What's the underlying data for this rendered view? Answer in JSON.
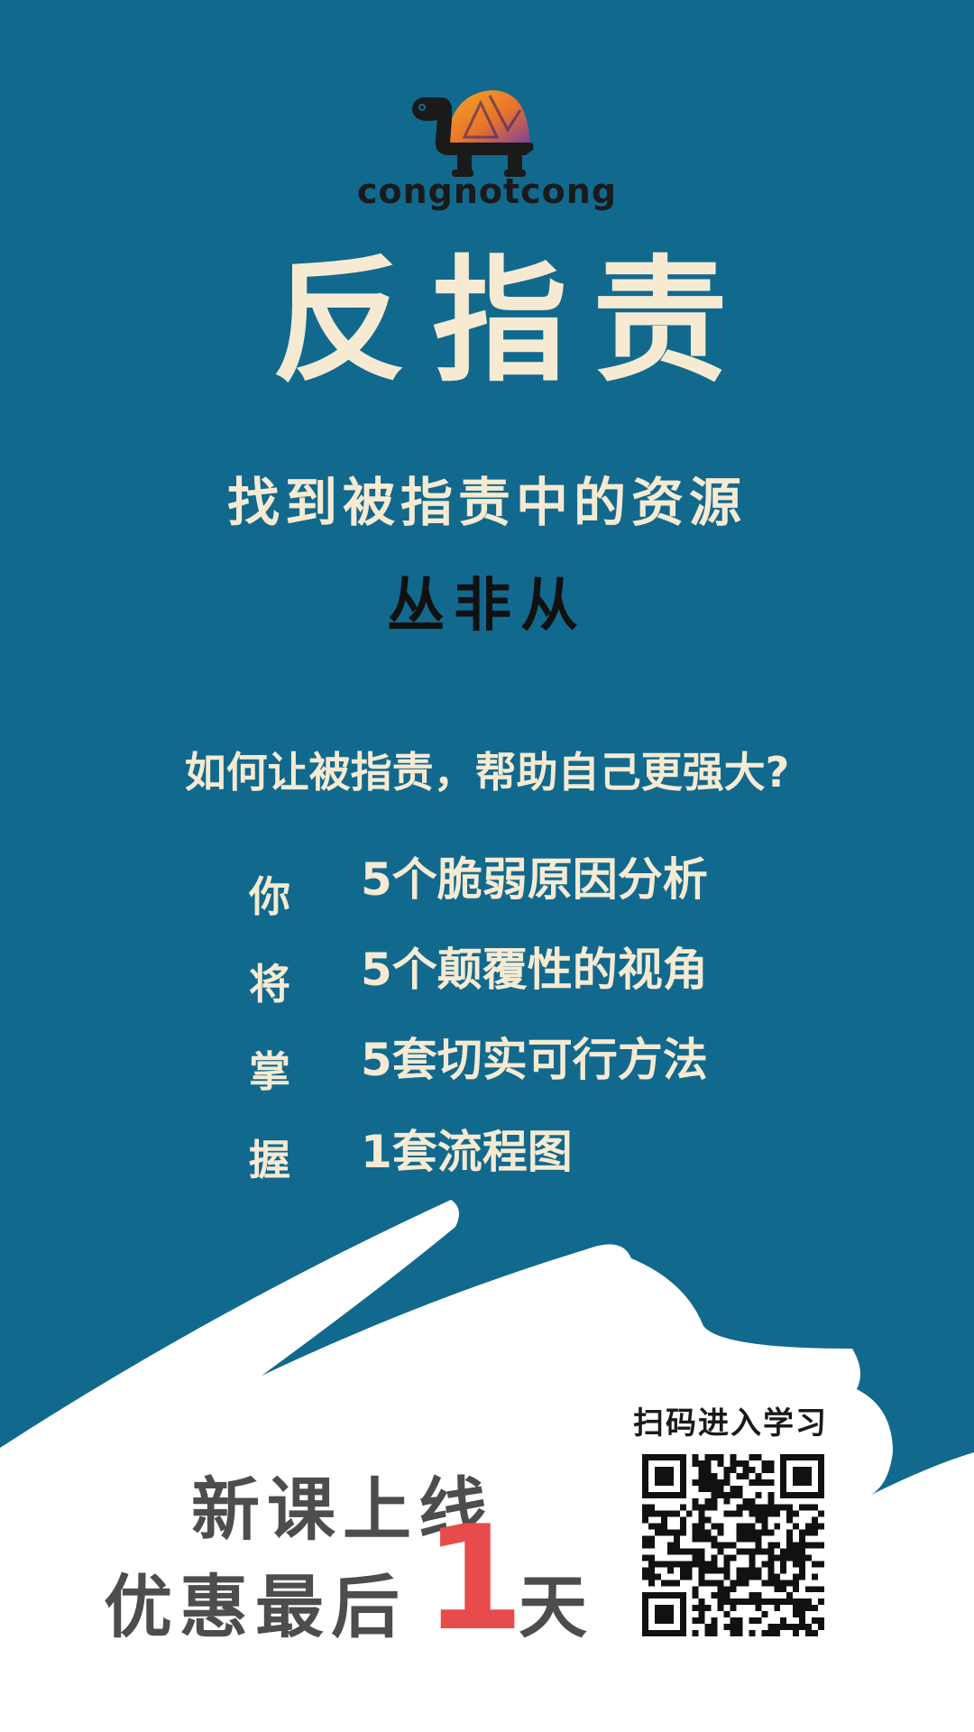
{
  "brand": {
    "name": "congnotcong"
  },
  "title": "反指责",
  "subtitle": "找到被指责中的资源",
  "author": "丛非从",
  "question": "如何让被指责，帮助自己更强大?",
  "side_chars": [
    "你",
    "将",
    "掌",
    "握"
  ],
  "learnings": [
    "5个脆弱原因分析",
    "5个颠覆性的视角",
    "5套切实可行方法",
    "1套流程图"
  ],
  "cta": {
    "line1": "新课上线",
    "line2_prefix": "优惠最后",
    "highlight": "1",
    "line2_suffix": "天",
    "highlight_color": "#e74b4b"
  },
  "qr": {
    "label": "扫码进入学习"
  },
  "colors": {
    "background": "#11698e",
    "cream": "#f6ead2",
    "wave": "#ffffff"
  }
}
